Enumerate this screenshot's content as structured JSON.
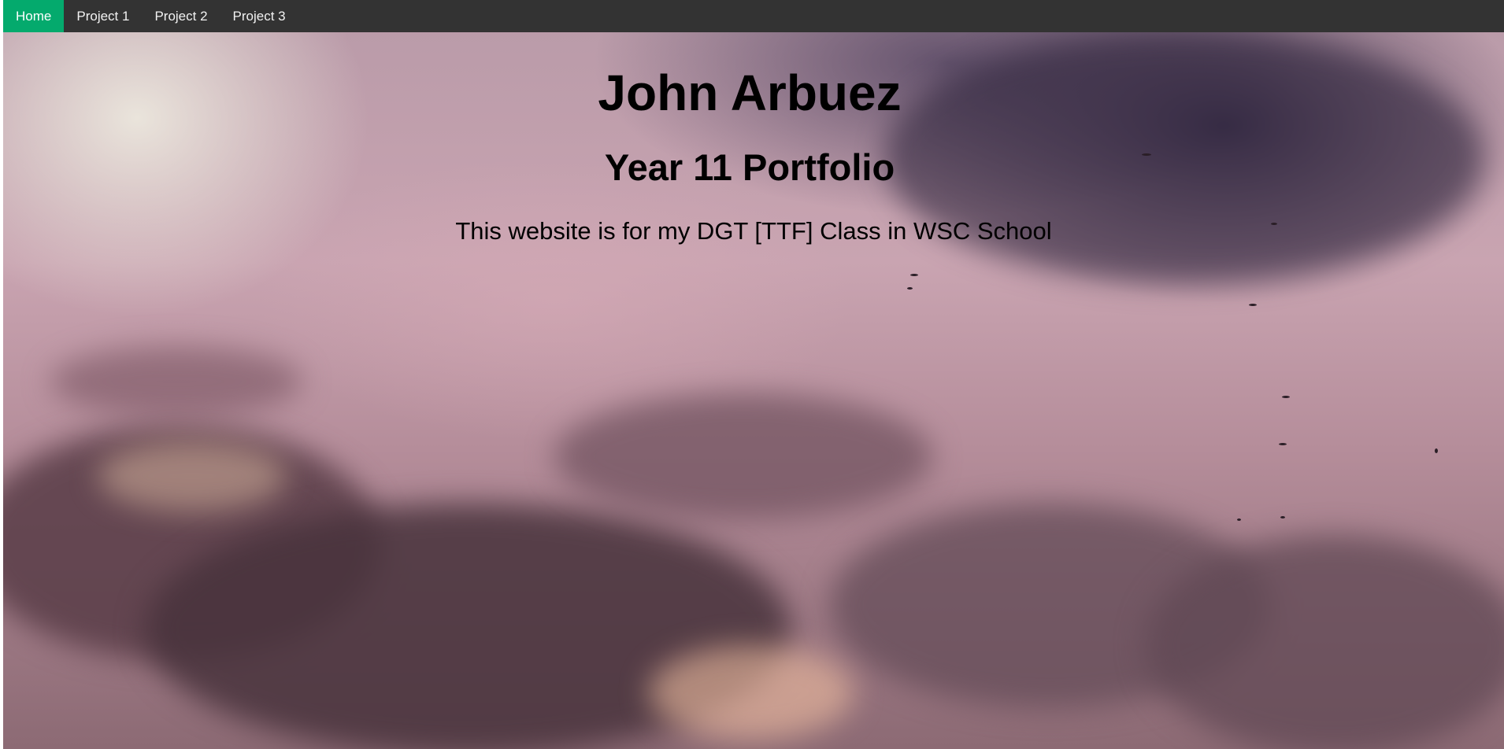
{
  "nav": {
    "items": [
      {
        "label": "Home",
        "active": true
      },
      {
        "label": "Project 1",
        "active": false
      },
      {
        "label": "Project 2",
        "active": false
      },
      {
        "label": "Project 3",
        "active": false
      }
    ]
  },
  "hero": {
    "title": "John Arbuez",
    "subtitle": "Year 11 Portfolio",
    "description": "This website is for my DGT [TTF] Class in WSC School"
  },
  "colors": {
    "navbar_bg": "#333333",
    "nav_active_bg": "#04aa6d",
    "nav_text": "#f2f2f2"
  },
  "background": {
    "icon": "cloudy-sunset-sky-image"
  }
}
